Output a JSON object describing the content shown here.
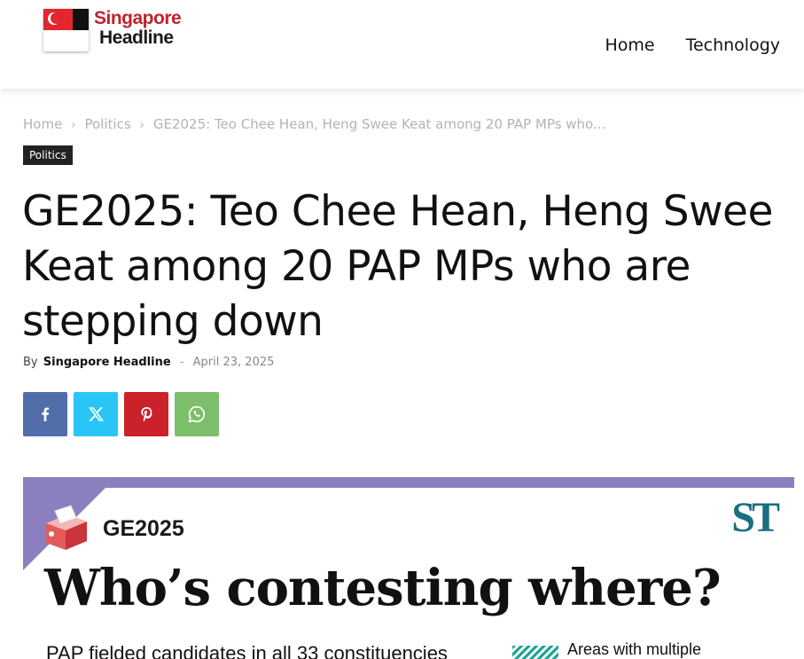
{
  "header": {
    "logo_line1": "Singapore",
    "logo_line2": "Headline",
    "nav": [
      "Home",
      "Technology"
    ]
  },
  "breadcrumb": {
    "items": [
      "Home",
      "Politics",
      "GE2025: Teo Chee Hean, Heng Swee Keat among 20 PAP MPs who..."
    ],
    "separator": "›"
  },
  "article": {
    "category": "Politics",
    "title": "GE2025: Teo Chee Hean, Heng Swee Keat among 20 PAP MPs who are stepping down",
    "by_label": "By",
    "author": "Singapore Headline",
    "separator": "-",
    "date": "April 23, 2025"
  },
  "share": {
    "buttons": [
      {
        "icon": "facebook-icon",
        "color": "#516eab"
      },
      {
        "icon": "x-icon",
        "color": "#29c5f6"
      },
      {
        "icon": "pinterest-icon",
        "color": "#ca212a"
      },
      {
        "icon": "whatsapp-icon",
        "color": "#7bbf6a"
      }
    ]
  },
  "graphic": {
    "tag": "GE2025",
    "publisher_logo": "ST",
    "headline": "Who’s contesting where?",
    "subtext": "PAP fielded candidates in all 33 constituencies",
    "legend": "Areas with multiple",
    "colors": {
      "accent": "#8b7fc0",
      "st": "#1b6d80",
      "legend": "#1aa596"
    }
  }
}
